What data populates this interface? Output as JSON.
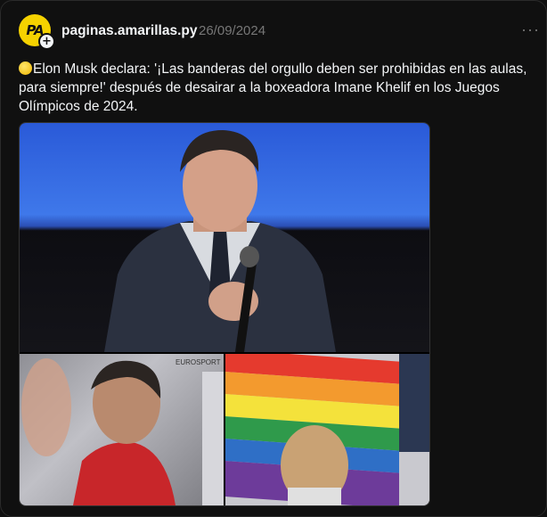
{
  "post": {
    "avatar_text": "PA",
    "username": "paginas.amarillas.py",
    "date": "26/09/2024",
    "more": "···",
    "text": "Elon Musk declara: '¡Las banderas del orgullo deben ser prohibidas en las aulas, para siempre!' después de desairar a la boxeadora Imane Khelif en los Juegos Olímpicos de 2024.",
    "emoji": "yellow-circle",
    "photo_caption": "EUROSPORT"
  },
  "colors": {
    "background": "#101010",
    "avatar": "#f5d200",
    "muted": "#777777"
  }
}
